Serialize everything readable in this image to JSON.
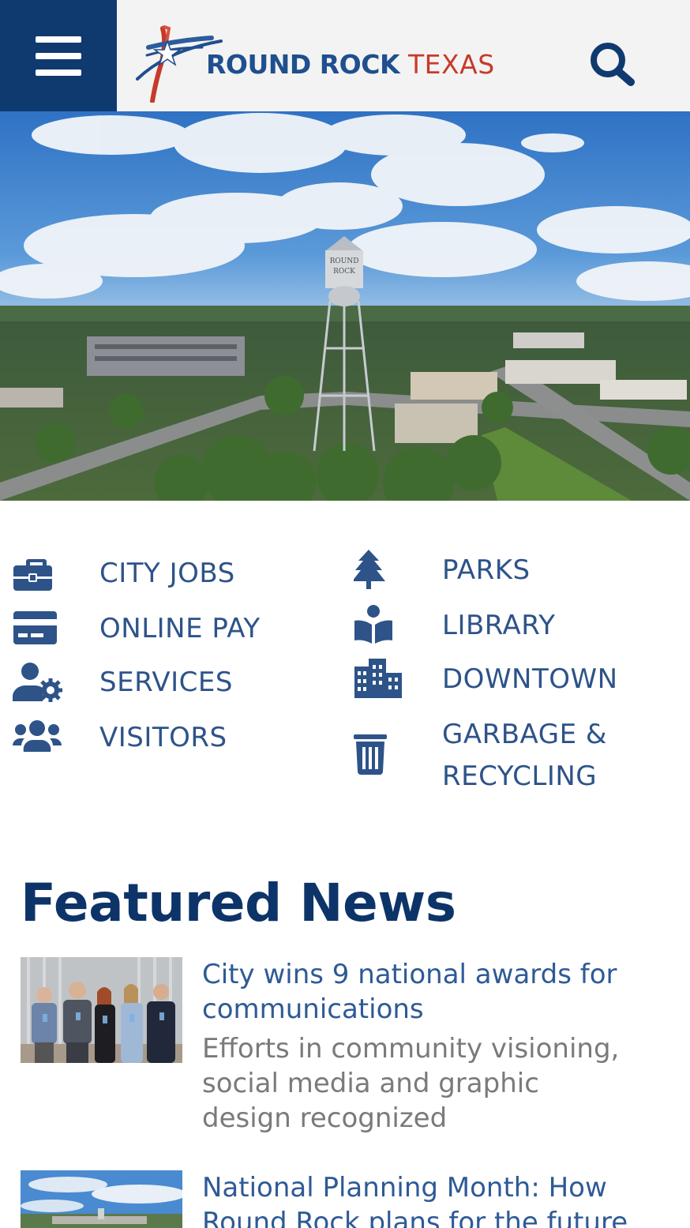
{
  "header": {
    "menu_icon": "hamburger-menu-icon",
    "logo_part1": "ROUND ROCK",
    "logo_part2": "TEXAS",
    "search_icon": "search-icon",
    "colors": {
      "nav_bg": "#0f3a70",
      "header_bg": "#f3f3f3",
      "brand_blue": "#1f4f8e",
      "brand_red": "#c73a2a"
    }
  },
  "hero": {
    "image": "aerial-downtown-water-tower",
    "tower_text_1": "ROUND",
    "tower_text_2": "ROCK"
  },
  "quick_links": [
    {
      "label": "CITY JOBS",
      "icon": "briefcase-icon"
    },
    {
      "label": "ONLINE PAY",
      "icon": "credit-card-icon"
    },
    {
      "label": "SERVICES",
      "icon": "user-gear-icon"
    },
    {
      "label": "VISITORS",
      "icon": "users-icon"
    },
    {
      "label": "PARKS",
      "icon": "tree-icon"
    },
    {
      "label": "LIBRARY",
      "icon": "book-reader-icon"
    },
    {
      "label": "DOWNTOWN",
      "icon": "city-icon"
    },
    {
      "label": "GARBAGE &",
      "label2": "RECYCLING",
      "icon": "trash-icon"
    }
  ],
  "featured": {
    "title": "Featured News",
    "items": [
      {
        "title_line1": "City wins 9 national awards for",
        "title_line2": "communications",
        "summary_line1": "Efforts in community visioning,",
        "summary_line2": "social media and graphic",
        "summary_line3": "design recognized"
      },
      {
        "title_line1": "National Planning Month: How",
        "title_line2": "Round Rock plans for the future"
      }
    ]
  }
}
